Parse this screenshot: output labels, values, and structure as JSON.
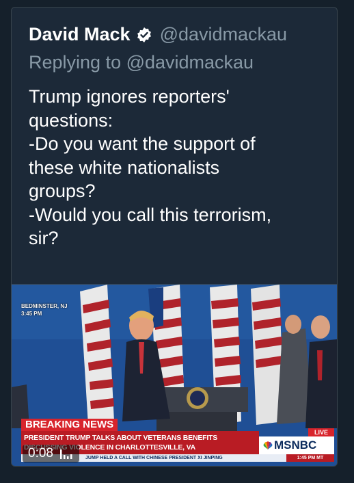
{
  "tweet": {
    "author_name": "David Mack",
    "author_handle": "@davidmackau",
    "replying_to": "Replying to @davidmackau",
    "text": "Trump ignores reporters'\nquestions:\n-Do you want the support of\nthese white nationalists\ngroups?\n-Would you call this terrorism,\nsir?",
    "verified_icon": "verified-badge-icon"
  },
  "video": {
    "dateline_place": "BEDMINSTER, NJ",
    "dateline_time": "3:45 PM",
    "breaking_label": "BREAKING NEWS",
    "headline_line1": "PRESIDENT TRUMP TALKS ABOUT VETERANS BENEFITS",
    "headline_line2": "DISCUSSING VIOLENCE IN CHARLOTTESVILLE, VA",
    "live_label": "LIVE",
    "network": "MSNBC",
    "ticker_text": "JUMP HELD A CALL WITH CHINESE PRESIDENT XI JINPING",
    "ticker_time": "1:45 PM MT",
    "elapsed": "0:08",
    "sound_icon": "sound-bars-icon"
  },
  "colors": {
    "background": "#15202b",
    "card": "#1c2938",
    "secondary_text": "#8899a6",
    "verified": "#ffffff",
    "breaking_red": "#d8242c"
  }
}
